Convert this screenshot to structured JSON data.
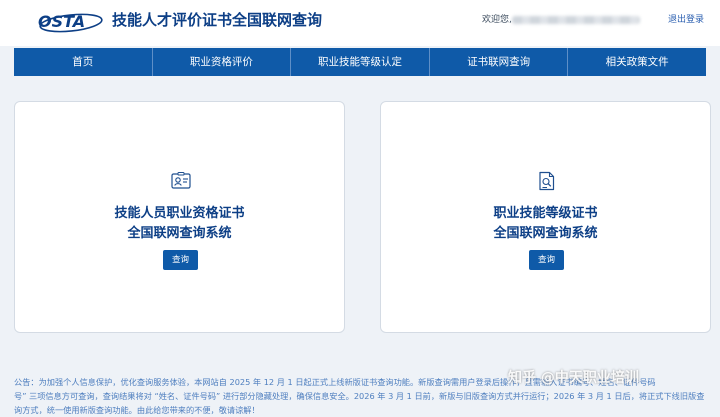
{
  "header": {
    "logo_text": "OSTA",
    "title": "技能人才评价证书全国联网查询",
    "welcome": "欢迎您,",
    "logout": "退出登录"
  },
  "nav": {
    "items": [
      {
        "label": "首页"
      },
      {
        "label": "职业资格评价"
      },
      {
        "label": "职业技能等级认定"
      },
      {
        "label": "证书联网查询"
      },
      {
        "label": "相关政策文件"
      }
    ]
  },
  "cards": [
    {
      "icon": "certificate-icon",
      "title_line1": "技能人员职业资格证书",
      "title_line2": "全国联网查询系统",
      "button": "查询"
    },
    {
      "icon": "document-search-icon",
      "title_line1": "职业技能等级证书",
      "title_line2": "全国联网查询系统",
      "button": "查询"
    }
  ],
  "notice": {
    "line1": "公告：为加强个人信息保护，优化查询服务体验，本网站自 2025 年 12 月 1 日起正式上线新版证书查询功能。新版查询需用户登录后操作，且需输入证书编号、姓名、证件号码",
    "line2": "号” 三项信息方可查询，查询结果将对 “姓名、证件号码” 进行部分隐藏处理，确保信息安全。2026 年 3 月 1 日前，新版与旧版查询方式并行运行；2026 年 3 月 1 日后，将正式下线旧版查",
    "line3": "询方式，统一使用新版查询功能。由此给您带来的不便，敬请谅解！"
  },
  "watermark": "知乎 @中天职业培训",
  "colors": {
    "brand": "#0f5aa8",
    "title": "#0d3f86",
    "background": "#eef2f7"
  }
}
